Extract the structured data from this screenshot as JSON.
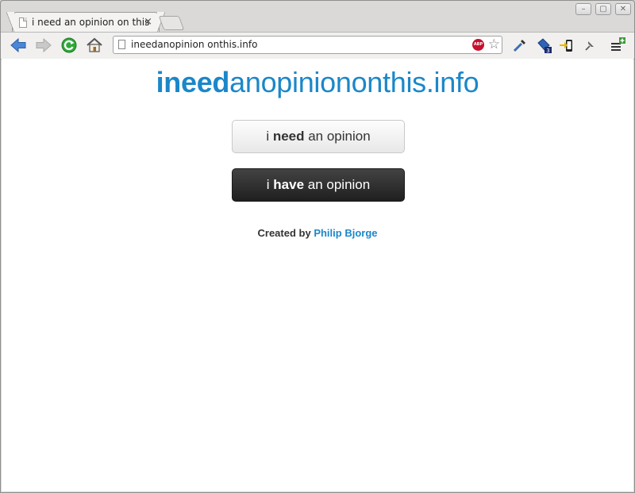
{
  "browser": {
    "tab": {
      "title": "i need an opinion on this",
      "close": "×"
    },
    "window_controls": {
      "minimize": "–",
      "maximize": "▢",
      "close": "✕"
    },
    "address_bar": {
      "url": "ineedanopinion onthis.info"
    },
    "extension_badge": "3",
    "abp_label": "ABP"
  },
  "page": {
    "title_bold": "ineed",
    "title_rest": "anopiniononthis.info",
    "need_button": {
      "prefix": "i ",
      "bold": "need",
      "suffix": " an opinion"
    },
    "have_button": {
      "prefix": "i ",
      "bold": "have",
      "suffix": " an opinion"
    },
    "credit": {
      "label": "Created by ",
      "author": "Philip Bjorge"
    }
  },
  "colors": {
    "accent": "#1b87c9",
    "dark_button": "#2a2a2a"
  }
}
